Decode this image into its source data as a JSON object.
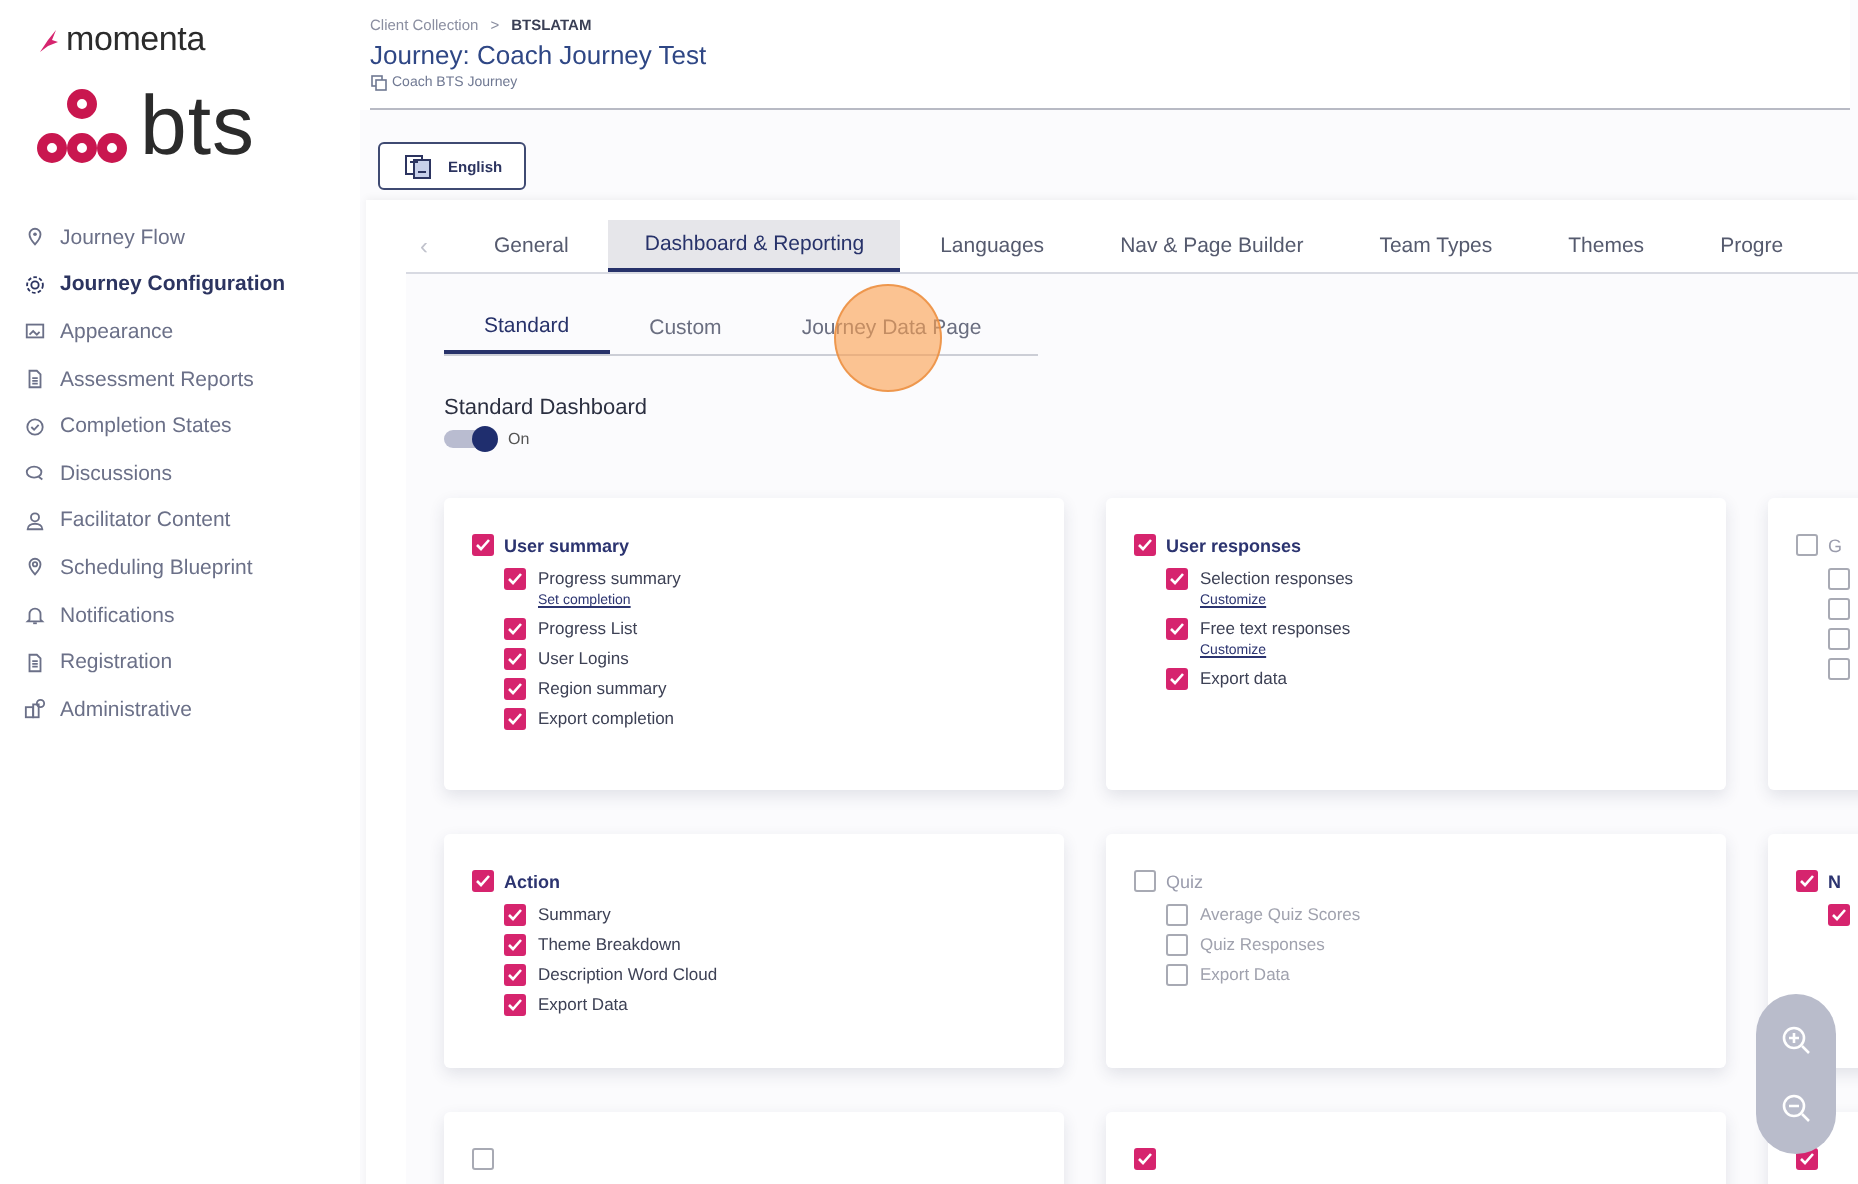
{
  "brand": {
    "wordmark": "momenta",
    "logo": "bts"
  },
  "sidebar": {
    "items": [
      {
        "label": "Journey Flow",
        "selected": false
      },
      {
        "label": "Journey Configuration",
        "selected": true
      },
      {
        "label": "Appearance",
        "selected": false
      },
      {
        "label": "Assessment Reports",
        "selected": false
      },
      {
        "label": "Completion States",
        "selected": false
      },
      {
        "label": "Discussions",
        "selected": false
      },
      {
        "label": "Facilitator Content",
        "selected": false
      },
      {
        "label": "Scheduling Blueprint",
        "selected": false
      },
      {
        "label": "Notifications",
        "selected": false
      },
      {
        "label": "Registration",
        "selected": false
      },
      {
        "label": "Administrative",
        "selected": false
      }
    ]
  },
  "breadcrumb": {
    "items": [
      "Client Collection",
      "BTSLATAM"
    ],
    "separator": ">"
  },
  "title": "Journey: Coach Journey Test",
  "subtitle": "Coach BTS Journey",
  "language_button": "English",
  "tabs_scroll": "‹",
  "tabs": [
    {
      "label": "General",
      "selected": false
    },
    {
      "label": "Dashboard & Reporting",
      "selected": true
    },
    {
      "label": "Languages",
      "selected": false
    },
    {
      "label": "Nav & Page Builder",
      "selected": false
    },
    {
      "label": "Team Types",
      "selected": false
    },
    {
      "label": "Themes",
      "selected": false
    },
    {
      "label": "Progre",
      "selected": false
    }
  ],
  "subtabs": [
    {
      "label": "Standard",
      "selected": true
    },
    {
      "label": "Custom",
      "selected": false
    },
    {
      "label": "Journey Data Page",
      "selected": false
    }
  ],
  "section_title": "Standard Dashboard",
  "toggle": {
    "on": true,
    "label": "On"
  },
  "cards": [
    {
      "title": "User summary",
      "checked": true,
      "items": [
        {
          "label": "Progress summary",
          "checked": true,
          "link": "Set completion"
        },
        {
          "label": "Progress List",
          "checked": true
        },
        {
          "label": "User Logins",
          "checked": true
        },
        {
          "label": "Region summary",
          "checked": true
        },
        {
          "label": "Export completion",
          "checked": true
        }
      ]
    },
    {
      "title": "User responses",
      "checked": true,
      "items": [
        {
          "label": "Selection responses",
          "checked": true,
          "link": "Customize"
        },
        {
          "label": "Free text responses",
          "checked": true,
          "link": "Customize"
        },
        {
          "label": "Export data",
          "checked": true
        }
      ]
    },
    {
      "title": "G",
      "checked": false,
      "items": [
        {
          "checked": false
        },
        {
          "checked": false
        },
        {
          "checked": false
        },
        {
          "checked": false
        }
      ]
    },
    {
      "title": "Action",
      "checked": true,
      "items": [
        {
          "label": "Summary",
          "checked": true
        },
        {
          "label": "Theme Breakdown",
          "checked": true
        },
        {
          "label": "Description Word Cloud",
          "checked": true
        },
        {
          "label": "Export Data",
          "checked": true
        }
      ]
    },
    {
      "title": "Quiz",
      "checked": false,
      "items": [
        {
          "label": "Average Quiz Scores",
          "checked": false
        },
        {
          "label": "Quiz Responses",
          "checked": false
        },
        {
          "label": "Export Data",
          "checked": false
        }
      ]
    },
    {
      "title": "N",
      "checked": true,
      "items": [
        {
          "checked": true
        }
      ]
    },
    {
      "checked": false
    },
    {
      "checked": true
    },
    {
      "checked": true
    }
  ]
}
